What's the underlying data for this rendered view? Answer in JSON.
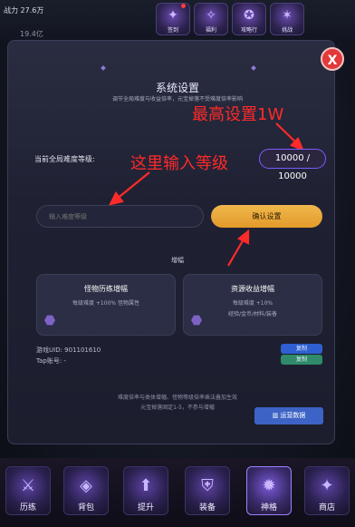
{
  "status": {
    "power": "战力 27.6万",
    "gold": "19.4亿"
  },
  "top_icons": [
    "签到",
    "福利",
    "攻略行",
    "挑战"
  ],
  "modal": {
    "title": "系统设置",
    "subtitle": "调节全局难度与收益倍率，元宝掉落不受难度倍率影响",
    "close_label": "X",
    "level_label": "当前全局难度等级:",
    "level_value": "10000 / 10000",
    "input_placeholder": "输入难度等级",
    "confirm_label": "确认设置",
    "section_title": "增幅",
    "cards": [
      {
        "title": "怪物历练增幅",
        "desc": "每级难度 +100% 怪物属性",
        "desc2": ""
      },
      {
        "title": "资源收益增幅",
        "desc": "每级难度 +10%",
        "desc2": "经验/金币/材料/装备"
      }
    ],
    "uid": "游戏UID: 901101610",
    "tap": "Tap账号: -",
    "copy_label": "复制",
    "copy_label2": "复制",
    "note1": "难度倍率与类体增幅、怪物等级倍率乘法叠加生效",
    "note2": "元宝掉落固定1-5，不参与增幅",
    "ops_label": "运营数据"
  },
  "annotations": {
    "max_setting": "最高设置1W",
    "input_here": "这里输入等级"
  },
  "bottom_nav": [
    "历练",
    "背包",
    "提升",
    "装备",
    "神格",
    "商店"
  ],
  "colors": {
    "accent_gold": "#e8a636",
    "annotation_red": "#ff2a2a",
    "close_red": "#e23a3a",
    "purple": "#7a5cff"
  }
}
